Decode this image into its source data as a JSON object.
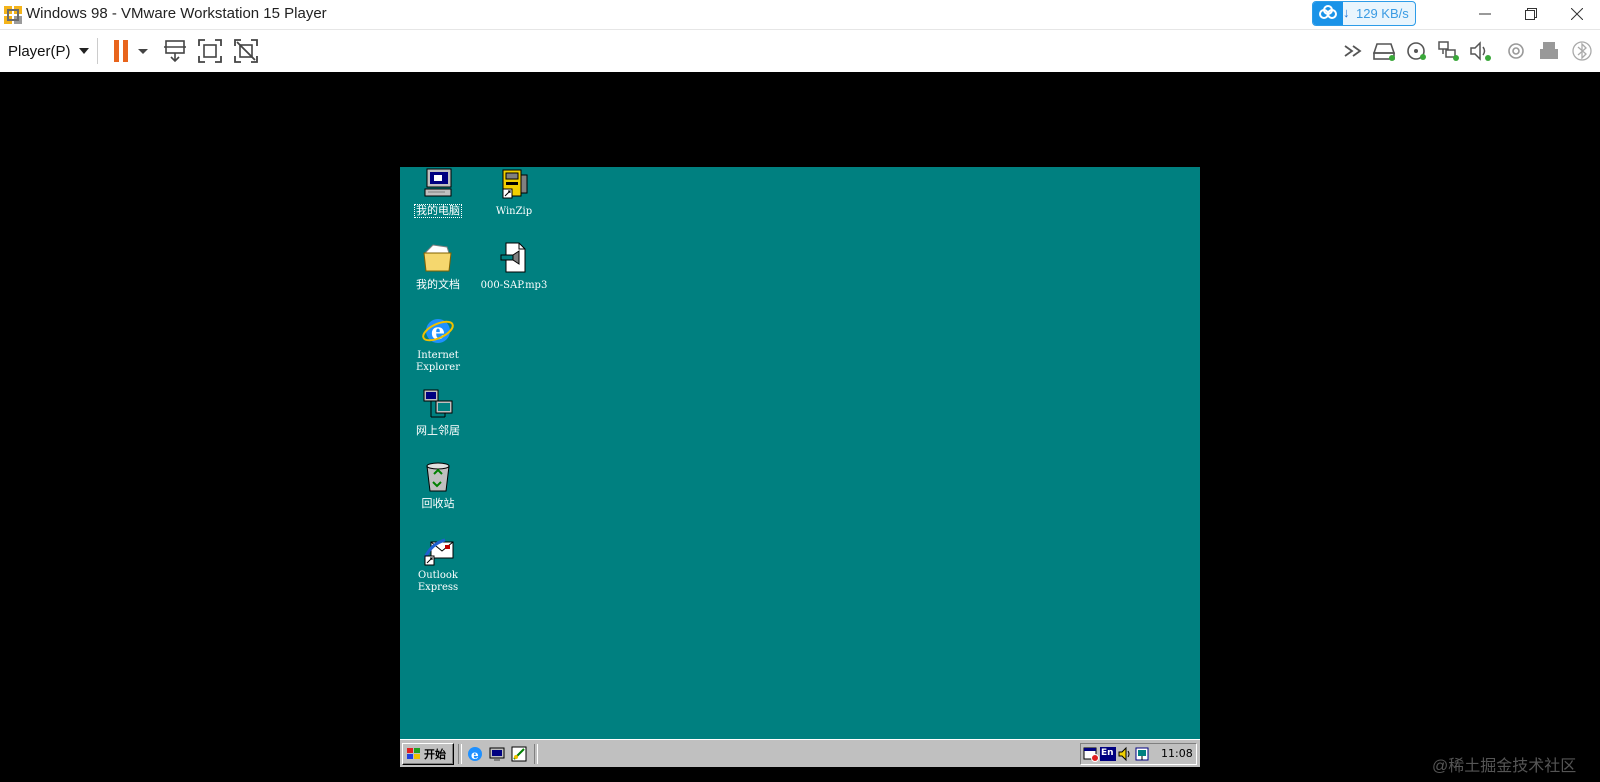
{
  "window": {
    "title": "Windows 98 - VMware Workstation 15 Player",
    "net_speed": "129 KB/s",
    "controls": [
      "minimize-icon",
      "restore-icon",
      "close-icon"
    ]
  },
  "toolbar": {
    "player_menu_label": "Player(P)",
    "left_icons": [
      "pause-icon",
      "dropdown-arrow-icon",
      "send-ctrl-alt-del-icon",
      "full-screen-icon",
      "unity-icon"
    ],
    "device_icons": [
      "more-devices-icon",
      "hard-disk-icon",
      "cd-dvd-icon",
      "network-adapter-icon",
      "sound-card-icon",
      "usb-controller-icon",
      "printer-icon",
      "bluetooth-icon"
    ]
  },
  "desktop": {
    "background_color": "#008080",
    "icons": [
      {
        "id": "my-computer",
        "label": "我的电脑",
        "icon": "computer-icon",
        "selected": true
      },
      {
        "id": "winzip",
        "label": "WinZip",
        "icon": "winzip-icon",
        "selected": false
      },
      {
        "id": "my-documents",
        "label": "我的文档",
        "icon": "folder-icon",
        "selected": false
      },
      {
        "id": "mp3-file",
        "label": "000-SAP.mp3",
        "icon": "audio-file-icon",
        "selected": false
      },
      {
        "id": "internet-explorer",
        "label_lines": [
          "Internet",
          "Explorer"
        ],
        "icon": "ie-icon",
        "selected": false
      },
      {
        "id": "network-neighborhood",
        "label": "网上邻居",
        "icon": "network-icon",
        "selected": false
      },
      {
        "id": "recycle-bin",
        "label": "回收站",
        "icon": "recycle-bin-icon",
        "selected": false
      },
      {
        "id": "outlook-express",
        "label_lines": [
          "Outlook",
          "Express"
        ],
        "icon": "outlook-express-icon",
        "selected": false
      }
    ]
  },
  "taskbar": {
    "start_label": "开始",
    "quick_launch": [
      "ie-icon",
      "show-desktop-icon",
      "channels-icon"
    ],
    "tray_icons": [
      "scheduler-icon",
      "input-language-icon",
      "volume-icon",
      "network-status-icon"
    ],
    "input_language": "En",
    "clock": "11:08"
  },
  "watermark": "@稀土掘金技术社区"
}
